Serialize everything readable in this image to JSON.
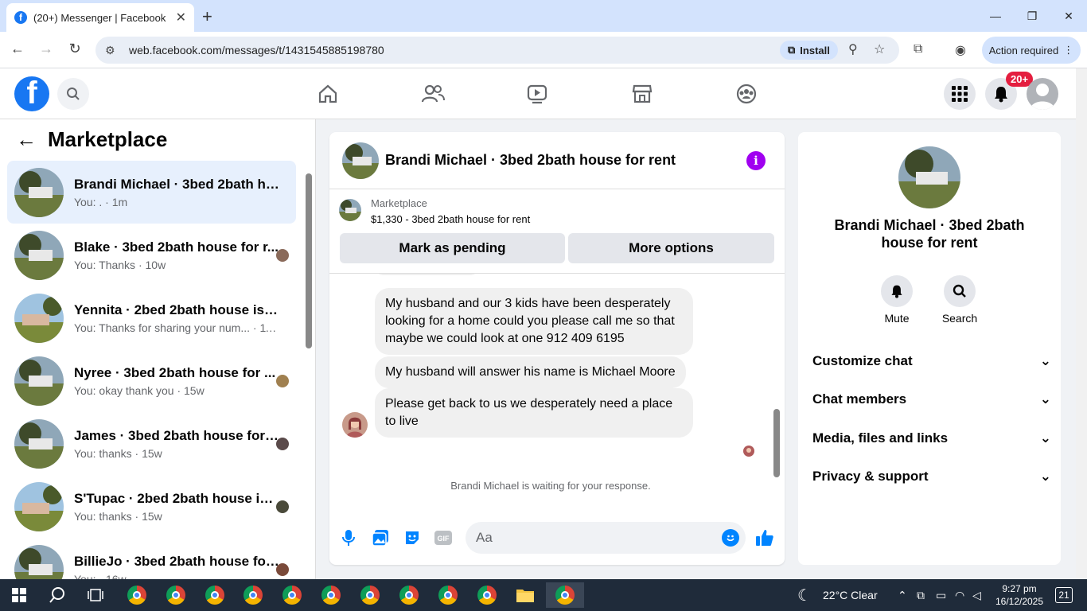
{
  "browser": {
    "tab_title": "(20+) Messenger | Facebook",
    "url": "web.facebook.com/messages/t/1431545885198780",
    "install_label": "Install",
    "action_required_label": "Action required"
  },
  "fb_header": {
    "notification_badge": "20+"
  },
  "left": {
    "title": "Marketplace",
    "conversations": [
      {
        "name": "Brandi Michael · 3bed 2bath hou...",
        "sub": "You: . · 1m",
        "active": true
      },
      {
        "name": "Blake · 3bed 2bath house for r...",
        "sub": "You: Thanks · 10w"
      },
      {
        "name": "Yennita · 2bed 2bath house is av...",
        "sub": "You: Thanks for sharing your num... · 11w"
      },
      {
        "name": "Nyree · 3bed 2bath house for ...",
        "sub": "You: okay thank you · 15w"
      },
      {
        "name": "James · 3bed 2bath house for ...",
        "sub": "You: thanks · 15w"
      },
      {
        "name": "S'Tupac · 2bed 2bath house is ...",
        "sub": "You: thanks · 15w"
      },
      {
        "name": "BillieJo · 3bed 2bath house for...",
        "sub": "You: · 16w"
      }
    ]
  },
  "chat": {
    "title": "Brandi Michael · 3bed 2bath house for rent",
    "marketplace_label": "Marketplace",
    "listing": "$1,330 - 3bed 2bath house for rent",
    "mark_pending_label": "Mark as pending",
    "more_options_label": "More options",
    "messages": [
      "My husband and our 3 kids have been desperately looking for a home could you please call me so that maybe we could look at one 912 409 6195",
      "My husband will answer his name is Michael Moore",
      "Please get back to us we desperately need a place to live"
    ],
    "waiting_text": "Brandi Michael is waiting for your response.",
    "composer_placeholder": "Aa"
  },
  "right": {
    "name": "Brandi Michael · 3bed 2bath house for rent",
    "mute_label": "Mute",
    "search_label": "Search",
    "sections": [
      "Customize chat",
      "Chat members",
      "Media, files and links",
      "Privacy & support"
    ]
  },
  "taskbar": {
    "weather": "22°C  Clear",
    "time": "9:27 pm",
    "date": "16/12/2025",
    "notification_count": "21"
  },
  "colors": {
    "fb_blue": "#1877f2",
    "active_row": "#e7f0fd",
    "info_purple": "#a000f0"
  }
}
